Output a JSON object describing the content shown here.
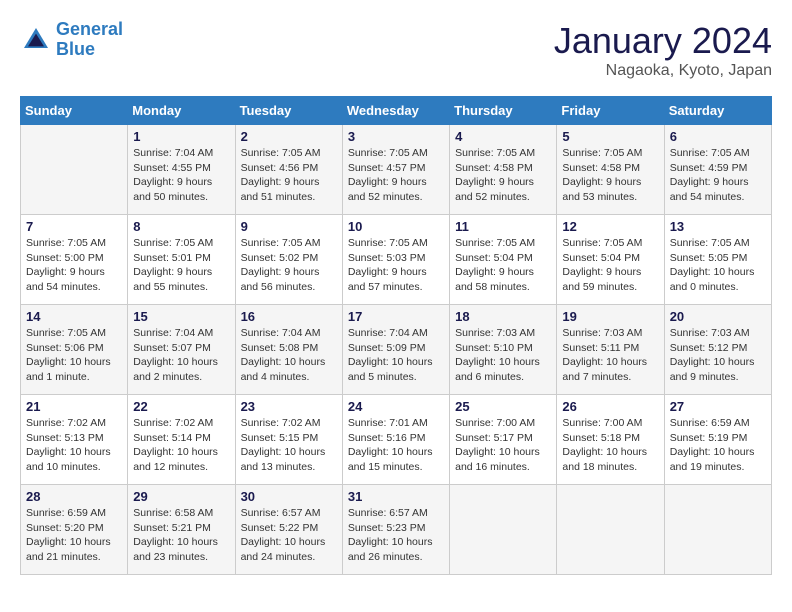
{
  "header": {
    "logo_line1": "General",
    "logo_line2": "Blue",
    "month_title": "January 2024",
    "location": "Nagaoka, Kyoto, Japan"
  },
  "days_of_week": [
    "Sunday",
    "Monday",
    "Tuesday",
    "Wednesday",
    "Thursday",
    "Friday",
    "Saturday"
  ],
  "weeks": [
    [
      {
        "day": "",
        "info": ""
      },
      {
        "day": "1",
        "info": "Sunrise: 7:04 AM\nSunset: 4:55 PM\nDaylight: 9 hours\nand 50 minutes."
      },
      {
        "day": "2",
        "info": "Sunrise: 7:05 AM\nSunset: 4:56 PM\nDaylight: 9 hours\nand 51 minutes."
      },
      {
        "day": "3",
        "info": "Sunrise: 7:05 AM\nSunset: 4:57 PM\nDaylight: 9 hours\nand 52 minutes."
      },
      {
        "day": "4",
        "info": "Sunrise: 7:05 AM\nSunset: 4:58 PM\nDaylight: 9 hours\nand 52 minutes."
      },
      {
        "day": "5",
        "info": "Sunrise: 7:05 AM\nSunset: 4:58 PM\nDaylight: 9 hours\nand 53 minutes."
      },
      {
        "day": "6",
        "info": "Sunrise: 7:05 AM\nSunset: 4:59 PM\nDaylight: 9 hours\nand 54 minutes."
      }
    ],
    [
      {
        "day": "7",
        "info": "Sunrise: 7:05 AM\nSunset: 5:00 PM\nDaylight: 9 hours\nand 54 minutes."
      },
      {
        "day": "8",
        "info": "Sunrise: 7:05 AM\nSunset: 5:01 PM\nDaylight: 9 hours\nand 55 minutes."
      },
      {
        "day": "9",
        "info": "Sunrise: 7:05 AM\nSunset: 5:02 PM\nDaylight: 9 hours\nand 56 minutes."
      },
      {
        "day": "10",
        "info": "Sunrise: 7:05 AM\nSunset: 5:03 PM\nDaylight: 9 hours\nand 57 minutes."
      },
      {
        "day": "11",
        "info": "Sunrise: 7:05 AM\nSunset: 5:04 PM\nDaylight: 9 hours\nand 58 minutes."
      },
      {
        "day": "12",
        "info": "Sunrise: 7:05 AM\nSunset: 5:04 PM\nDaylight: 9 hours\nand 59 minutes."
      },
      {
        "day": "13",
        "info": "Sunrise: 7:05 AM\nSunset: 5:05 PM\nDaylight: 10 hours\nand 0 minutes."
      }
    ],
    [
      {
        "day": "14",
        "info": "Sunrise: 7:05 AM\nSunset: 5:06 PM\nDaylight: 10 hours\nand 1 minute."
      },
      {
        "day": "15",
        "info": "Sunrise: 7:04 AM\nSunset: 5:07 PM\nDaylight: 10 hours\nand 2 minutes."
      },
      {
        "day": "16",
        "info": "Sunrise: 7:04 AM\nSunset: 5:08 PM\nDaylight: 10 hours\nand 4 minutes."
      },
      {
        "day": "17",
        "info": "Sunrise: 7:04 AM\nSunset: 5:09 PM\nDaylight: 10 hours\nand 5 minutes."
      },
      {
        "day": "18",
        "info": "Sunrise: 7:03 AM\nSunset: 5:10 PM\nDaylight: 10 hours\nand 6 minutes."
      },
      {
        "day": "19",
        "info": "Sunrise: 7:03 AM\nSunset: 5:11 PM\nDaylight: 10 hours\nand 7 minutes."
      },
      {
        "day": "20",
        "info": "Sunrise: 7:03 AM\nSunset: 5:12 PM\nDaylight: 10 hours\nand 9 minutes."
      }
    ],
    [
      {
        "day": "21",
        "info": "Sunrise: 7:02 AM\nSunset: 5:13 PM\nDaylight: 10 hours\nand 10 minutes."
      },
      {
        "day": "22",
        "info": "Sunrise: 7:02 AM\nSunset: 5:14 PM\nDaylight: 10 hours\nand 12 minutes."
      },
      {
        "day": "23",
        "info": "Sunrise: 7:02 AM\nSunset: 5:15 PM\nDaylight: 10 hours\nand 13 minutes."
      },
      {
        "day": "24",
        "info": "Sunrise: 7:01 AM\nSunset: 5:16 PM\nDaylight: 10 hours\nand 15 minutes."
      },
      {
        "day": "25",
        "info": "Sunrise: 7:00 AM\nSunset: 5:17 PM\nDaylight: 10 hours\nand 16 minutes."
      },
      {
        "day": "26",
        "info": "Sunrise: 7:00 AM\nSunset: 5:18 PM\nDaylight: 10 hours\nand 18 minutes."
      },
      {
        "day": "27",
        "info": "Sunrise: 6:59 AM\nSunset: 5:19 PM\nDaylight: 10 hours\nand 19 minutes."
      }
    ],
    [
      {
        "day": "28",
        "info": "Sunrise: 6:59 AM\nSunset: 5:20 PM\nDaylight: 10 hours\nand 21 minutes."
      },
      {
        "day": "29",
        "info": "Sunrise: 6:58 AM\nSunset: 5:21 PM\nDaylight: 10 hours\nand 23 minutes."
      },
      {
        "day": "30",
        "info": "Sunrise: 6:57 AM\nSunset: 5:22 PM\nDaylight: 10 hours\nand 24 minutes."
      },
      {
        "day": "31",
        "info": "Sunrise: 6:57 AM\nSunset: 5:23 PM\nDaylight: 10 hours\nand 26 minutes."
      },
      {
        "day": "",
        "info": ""
      },
      {
        "day": "",
        "info": ""
      },
      {
        "day": "",
        "info": ""
      }
    ]
  ]
}
